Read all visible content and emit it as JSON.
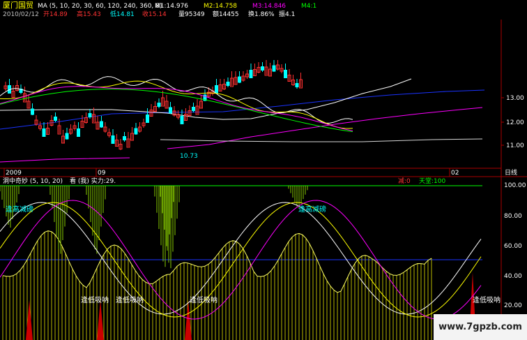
{
  "header": {
    "stock_name": "厦门国贸",
    "ma_params": "MA (5, 10, 20, 30, 60, 120, 240, 360, 8)",
    "ma_values": [
      {
        "label": "M1:14.976",
        "color": "#ffffff"
      },
      {
        "label": "M2:14.758",
        "color": "#ffff00"
      },
      {
        "label": "M3:14.846",
        "color": "#ff00ff"
      },
      {
        "label": "M4:1",
        "color": "#00ff00"
      }
    ],
    "date": "2010/02/12",
    "quote": [
      {
        "label": "开14.89",
        "color": "#ff3333"
      },
      {
        "label": "高15.43",
        "color": "#ff3333"
      },
      {
        "label": "低14.81",
        "color": "#00ffff"
      },
      {
        "label": "收15.14",
        "color": "#ff3333"
      },
      {
        "label": "量95349",
        "color": "#ffffff"
      },
      {
        "label": "额14455",
        "color": "#ffffff"
      },
      {
        "label": "换1.86%",
        "color": "#ffffff"
      },
      {
        "label": "振4.1",
        "color": "#ffffff"
      }
    ]
  },
  "price_axis": [
    "13.00",
    "12.00",
    "11.00"
  ],
  "low_marker": "10.73",
  "time_axis": [
    "2009",
    "09",
    "02"
  ],
  "period_tab": "日线",
  "indicator": {
    "title": "洞中奇妙 (5, 10, 20)",
    "watch_label": "看 (我) 实力:29.",
    "jian_label": "减:0",
    "tiantang_label": "天堂:100",
    "axis": [
      "100.00",
      "80.00",
      "60.00",
      "40.00",
      "20.00"
    ],
    "annotations": {
      "high": "逢高减磅",
      "low": "逢低吸呐"
    }
  },
  "watermark": "www.7gpzb.com",
  "colors": {
    "up": "#ff3030",
    "down": "#00ffff",
    "ma_white": "#ffffff",
    "ma_yellow": "#ffff00",
    "ma_magenta": "#ff00ff",
    "ma_green": "#00ff00",
    "ma_blue": "#1a33ff",
    "axis_red": "#aa0000"
  }
}
